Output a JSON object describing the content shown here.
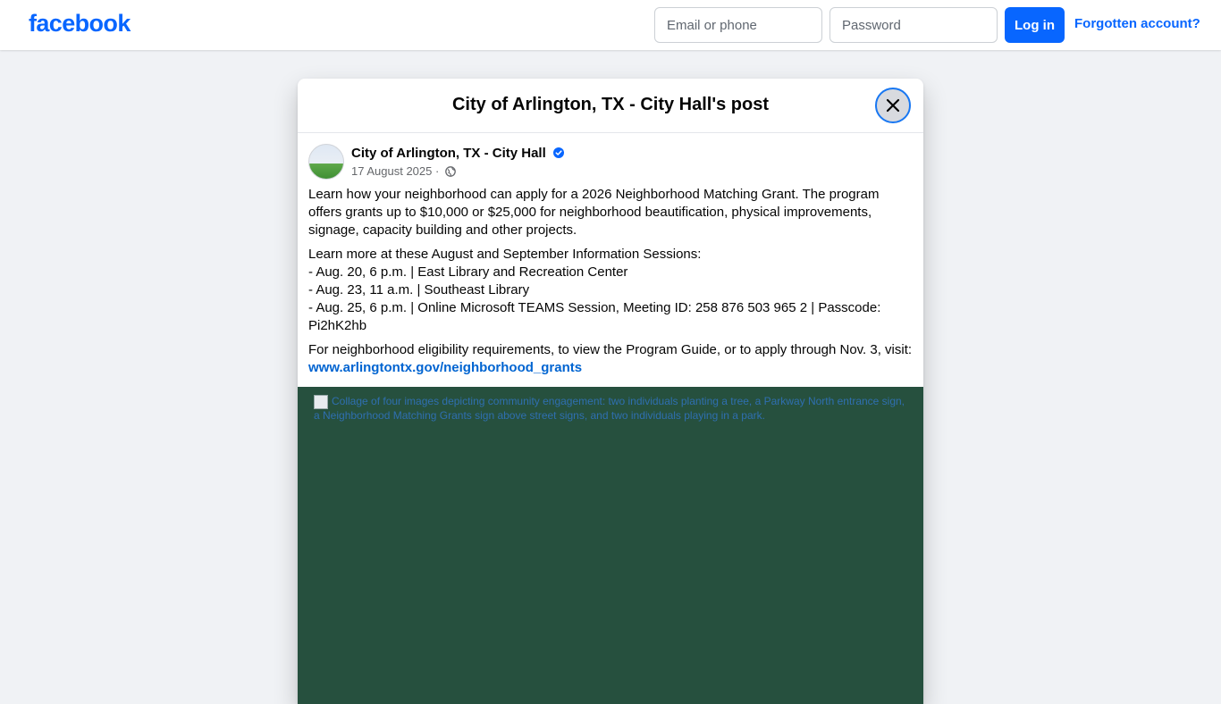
{
  "header": {
    "logo": "facebook",
    "email_placeholder": "Email or phone",
    "password_placeholder": "Password",
    "login_label": "Log in",
    "forgot_label": "Forgotten account?",
    "brand_color": "#0866ff"
  },
  "modal": {
    "title": "City of Arlington, TX - City Hall's post",
    "close_icon": "close-icon"
  },
  "post": {
    "author": "City of Arlington, TX - City Hall",
    "verified_icon": "verified-badge-icon",
    "date": "17 August 2025",
    "separator": " · ",
    "audience_icon": "globe-icon",
    "paragraph1": "Learn how your neighborhood can apply for a 2026 Neighborhood Matching Grant. The program offers grants up to $10,000 or $25,000 for neighborhood beautification, physical improvements, signage, capacity building and other projects.",
    "sessions_intro": "Learn more at these August and September Information Sessions:",
    "session1": "- Aug. 20, 6 p.m. | East Library and Recreation Center",
    "session2": "- Aug. 23, 11 a.m. | Southeast Library",
    "session3": "- Aug. 25, 6 p.m. | Online Microsoft TEAMS Session, Meeting ID: 258 876 503 965 2 | Passcode: Pi2hK2hb",
    "paragraph3": "For neighborhood eligibility requirements, to view the Program Guide, or to apply through Nov. 3, visit:",
    "link": "www.arlingtontx.gov/neighborhood_grants",
    "image_alt": "Collage of four images depicting community engagement: two individuals planting a tree, a Parkway North entrance sign, a Neighborhood Matching Grants sign above street signs, and two individuals playing in a park.",
    "image_bg_color": "#26503e"
  }
}
